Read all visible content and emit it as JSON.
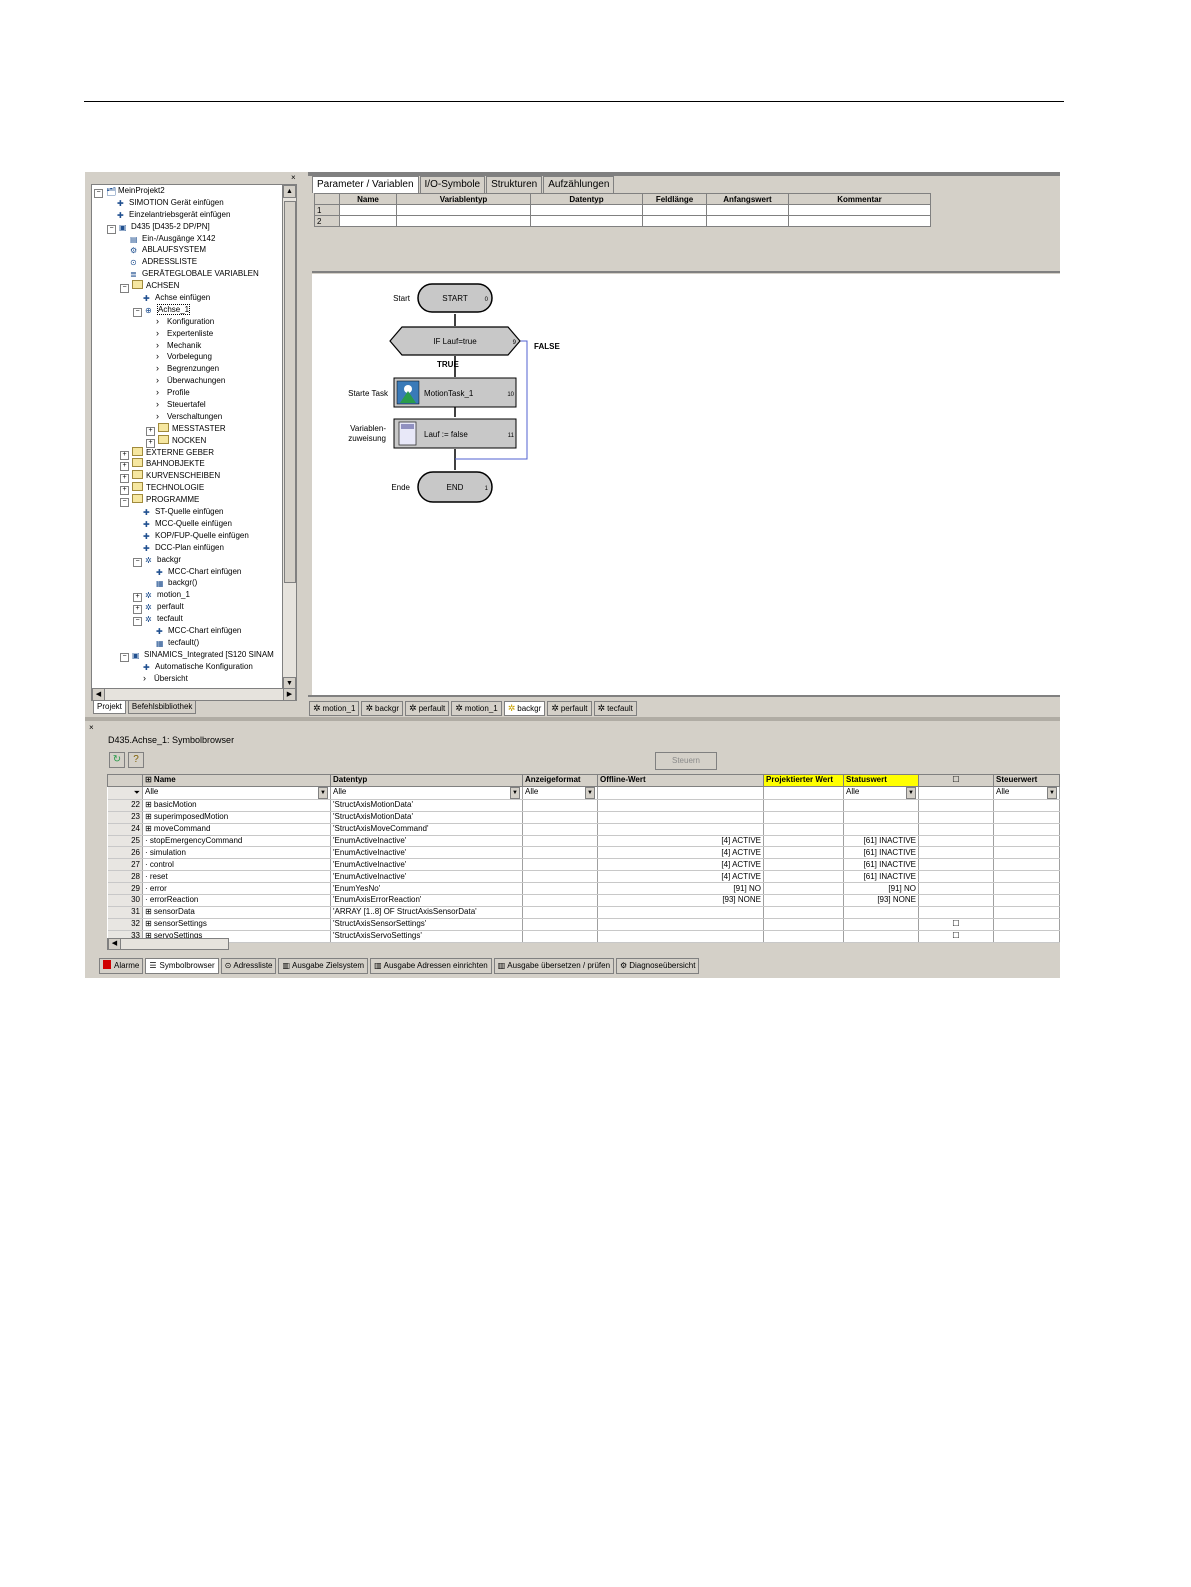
{
  "tree": {
    "items": [
      {
        "level": 0,
        "exp": "⊟",
        "icon": "project-icon",
        "label": "MeinProjekt2"
      },
      {
        "level": 1,
        "icon": "insert-icon",
        "label": "SIMOTION Gerät einfügen"
      },
      {
        "level": 1,
        "icon": "insert-icon",
        "label": "Einzelantriebsgerät einfügen"
      },
      {
        "level": 1,
        "exp": "⊟",
        "icon": "device-icon",
        "label": "D435 [D435-2 DP/PN]"
      },
      {
        "level": 2,
        "icon": "io-icon",
        "label": "Ein-/Ausgänge X142"
      },
      {
        "level": 2,
        "icon": "system-icon",
        "label": "ABLAUFSYSTEM"
      },
      {
        "level": 2,
        "icon": "address-icon",
        "label": "ADRESSLISTE"
      },
      {
        "level": 2,
        "icon": "variables-icon",
        "label": "GERÄTEGLOBALE VARIABLEN"
      },
      {
        "level": 2,
        "exp": "⊟",
        "icon": "folder-icon",
        "label": "ACHSEN"
      },
      {
        "level": 3,
        "icon": "insert-icon",
        "label": "Achse einfügen"
      },
      {
        "level": 3,
        "exp": "⊟",
        "icon": "axis-icon",
        "label": "Achse_1"
      },
      {
        "level": 4,
        "icon": "chevron-icon",
        "label": "Konfiguration"
      },
      {
        "level": 4,
        "icon": "chevron-icon",
        "label": "Expertenliste"
      },
      {
        "level": 4,
        "icon": "chevron-icon",
        "label": "Mechanik"
      },
      {
        "level": 4,
        "icon": "chevron-icon",
        "label": "Vorbelegung"
      },
      {
        "level": 4,
        "icon": "chevron-icon",
        "label": "Begrenzungen"
      },
      {
        "level": 4,
        "icon": "chevron-icon",
        "label": "Überwachungen"
      },
      {
        "level": 4,
        "icon": "chevron-icon",
        "label": "Profile"
      },
      {
        "level": 4,
        "icon": "chevron-icon",
        "label": "Steuertafel"
      },
      {
        "level": 4,
        "icon": "chevron-icon",
        "label": "Verschaltungen"
      },
      {
        "level": 4,
        "exp": "⊞",
        "icon": "folder-icon",
        "label": "MESSTASTER"
      },
      {
        "level": 4,
        "exp": "⊞",
        "icon": "folder-icon",
        "label": "NOCKEN"
      },
      {
        "level": 2,
        "exp": "⊞",
        "icon": "folder-icon",
        "label": "EXTERNE GEBER"
      },
      {
        "level": 2,
        "exp": "⊞",
        "icon": "folder-icon",
        "label": "BAHNOBJEKTE"
      },
      {
        "level": 2,
        "exp": "⊞",
        "icon": "folder-icon",
        "label": "KURVENSCHEIBEN"
      },
      {
        "level": 2,
        "exp": "⊞",
        "icon": "folder-icon",
        "label": "TECHNOLOGIE"
      },
      {
        "level": 2,
        "exp": "⊟",
        "icon": "folder-icon",
        "label": "PROGRAMME"
      },
      {
        "level": 3,
        "icon": "insert-icon",
        "label": "ST-Quelle einfügen"
      },
      {
        "level": 3,
        "icon": "insert-icon",
        "label": "MCC-Quelle einfügen"
      },
      {
        "level": 3,
        "icon": "insert-icon",
        "label": "KOP/FUP-Quelle einfügen"
      },
      {
        "level": 3,
        "icon": "insert-icon",
        "label": "DCC-Plan einfügen"
      },
      {
        "level": 3,
        "exp": "⊟",
        "icon": "program-icon",
        "label": "backgr"
      },
      {
        "level": 4,
        "icon": "insert-icon",
        "label": "MCC-Chart einfügen"
      },
      {
        "level": 4,
        "icon": "chart-icon",
        "label": "backgr()"
      },
      {
        "level": 3,
        "exp": "⊞",
        "icon": "program-icon",
        "label": "motion_1"
      },
      {
        "level": 3,
        "exp": "⊞",
        "icon": "program-icon",
        "label": "perfault"
      },
      {
        "level": 3,
        "exp": "⊟",
        "icon": "program-icon",
        "label": "tecfault"
      },
      {
        "level": 4,
        "icon": "insert-icon",
        "label": "MCC-Chart einfügen"
      },
      {
        "level": 4,
        "icon": "chart-icon",
        "label": "tecfault()"
      },
      {
        "level": 2,
        "exp": "⊟",
        "icon": "device-icon",
        "label": "SINAMICS_Integrated [S120 SINAM"
      },
      {
        "level": 3,
        "icon": "insert-icon",
        "label": "Automatische Konfiguration"
      },
      {
        "level": 3,
        "icon": "chevron-icon",
        "label": "Übersicht"
      }
    ],
    "bottom_tabs": [
      "Projekt",
      "Befehlsbibliothek"
    ]
  },
  "editor": {
    "tabs": [
      "Parameter / Variablen",
      "I/O-Symbole",
      "Strukturen",
      "Aufzählungen"
    ],
    "columns": [
      "Name",
      "Variablentyp",
      "Datentyp",
      "Feldlänge",
      "Anfangswert",
      "Kommentar"
    ],
    "rows": [
      "1",
      "2"
    ],
    "flow": {
      "start_label": "Start",
      "start": "START",
      "start_num": "0",
      "if_text": "IF Lauf=true",
      "if_num": "9",
      "false_label": "FALSE",
      "true_label": "TRUE",
      "task_label": "Starte Task",
      "task_text": "MotionTask_1",
      "task_num": "10",
      "assign_label1": "Variablen-",
      "assign_label2": "zuweisung",
      "assign_text": "Lauf := false",
      "assign_num": "11",
      "end_label": "Ende",
      "end": "END",
      "end_num": "1"
    },
    "chart_tabs": [
      "motion_1",
      "backgr",
      "perfault",
      "motion_1",
      "backgr",
      "perfault",
      "tecfault"
    ]
  },
  "symbol_browser": {
    "title": "D435.Achse_1: Symbolbrowser",
    "steuern": "Steuern",
    "columns": [
      "⊞ Name",
      "Datentyp",
      "Anzeigeformat",
      "Offline-Wert",
      "Projektierter Wert",
      "Statuswert",
      "",
      "",
      "Steuerwert"
    ],
    "filters": [
      "Alle",
      "Alle",
      "Alle",
      "Alle",
      "",
      "",
      "Alle",
      "",
      "Alle"
    ],
    "rows": [
      {
        "n": "22",
        "name": "⊞ basicMotion",
        "type": "'StructAxisMotionData'",
        "off": "",
        "status": "",
        "chk": ""
      },
      {
        "n": "23",
        "name": "⊞ superimposedMotion",
        "type": "'StructAxisMotionData'",
        "off": "",
        "status": "",
        "chk": ""
      },
      {
        "n": "24",
        "name": "⊞ moveCommand",
        "type": "'StructAxisMoveCommand'",
        "off": "",
        "status": "",
        "chk": ""
      },
      {
        "n": "25",
        "name": "· stopEmergencyCommand",
        "type": "'EnumActiveInactive'",
        "off": "[4] ACTIVE",
        "status": "[61] INACTIVE",
        "chk": ""
      },
      {
        "n": "26",
        "name": "· simulation",
        "type": "'EnumActiveInactive'",
        "off": "[4] ACTIVE",
        "status": "[61] INACTIVE",
        "chk": ""
      },
      {
        "n": "27",
        "name": "· control",
        "type": "'EnumActiveInactive'",
        "off": "[4] ACTIVE",
        "status": "[61] INACTIVE",
        "chk": ""
      },
      {
        "n": "28",
        "name": "· reset",
        "type": "'EnumActiveInactive'",
        "off": "[4] ACTIVE",
        "status": "[61] INACTIVE",
        "chk": ""
      },
      {
        "n": "29",
        "name": "· error",
        "type": "'EnumYesNo'",
        "off": "[91] NO",
        "status": "[91] NO",
        "chk": ""
      },
      {
        "n": "30",
        "name": "· errorReaction",
        "type": "'EnumAxisErrorReaction'",
        "off": "[93] NONE",
        "status": "[93] NONE",
        "chk": ""
      },
      {
        "n": "31",
        "name": "⊞ sensorData",
        "type": "'ARRAY [1..8] OF StructAxisSensorData'",
        "off": "",
        "status": "",
        "chk": ""
      },
      {
        "n": "32",
        "name": "⊞ sensorSettings",
        "type": "'StructAxisSensorSettings'",
        "off": "",
        "status": "",
        "chk": "☐"
      },
      {
        "n": "33",
        "name": "⊞ servoSettings",
        "type": "'StructAxisServoSettings'",
        "off": "",
        "status": "",
        "chk": "☐"
      }
    ]
  },
  "statusbar": [
    "Alarme",
    "Symbolbrowser",
    "Adressliste",
    "Ausgabe Zielsystem",
    "Ausgabe Adressen einrichten",
    "Ausgabe übersetzen / prüfen",
    "Diagnoseübersicht"
  ],
  "colors": {
    "highlight": "#ffff00",
    "flow_line": "#5060d0",
    "window_bg": "#d4d0c8"
  }
}
